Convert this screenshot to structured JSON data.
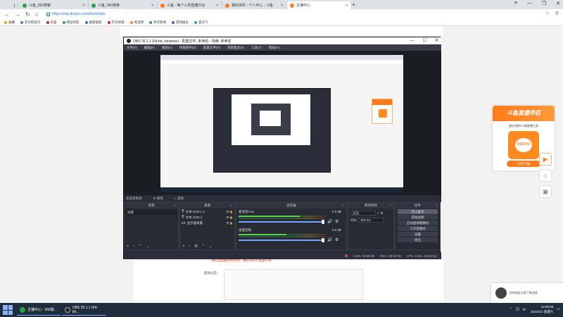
{
  "browser": {
    "tabs": [
      {
        "label": "斗鱼_360搜索",
        "active": false
      },
      {
        "label": "斗鱼_360搜索",
        "active": false
      },
      {
        "label": "斗鱼 - 每个人的直播平台",
        "active": false
      },
      {
        "label": "我的资料 - 个人中心 - 斗鱼",
        "active": false
      },
      {
        "label": "主播中心",
        "active": true
      }
    ],
    "url": "https://mp.douyu.com/live/main",
    "bookmarks": [
      {
        "label": "收藏",
        "color": "#f0a020"
      },
      {
        "label": "老司机首页",
        "color": "#3b7de0"
      },
      {
        "label": "天猫",
        "color": "#e02020"
      },
      {
        "label": "网址导航",
        "color": "#2aa04a"
      },
      {
        "label": "搜索搜索",
        "color": "#2a6de0"
      },
      {
        "label": "京东商城",
        "color": "#e02020"
      },
      {
        "label": "淘宝网",
        "color": "#ff7a1a"
      },
      {
        "label": "热点新闻",
        "color": "#3b7de0"
      },
      {
        "label": "游戏娱乐",
        "color": "#7a3be0"
      },
      {
        "label": "查天气",
        "color": "#20a0e0"
      }
    ]
  },
  "obs": {
    "title": "OBS 26.1.1 (64-bit, windows) - 配置文件: 未命名 - 场景: 未命名",
    "menu": [
      "文件(F)",
      "编辑(E)",
      "视图(V)",
      "停靠部件(D)",
      "配置文件(P)",
      "场景集合(S)",
      "工具(T)",
      "帮助(H)"
    ],
    "source_bar": {
      "none_selected": "未选择来源",
      "properties": "属性",
      "filters": "滤镜"
    },
    "scenes": {
      "header": "场景",
      "items": [
        "场景"
      ]
    },
    "sources": {
      "header": "来源",
      "items": [
        {
          "type": "T",
          "label": "文本 (GDI+) 2"
        },
        {
          "type": "T",
          "label": "文本 (GDI+)"
        },
        {
          "type": "▭",
          "label": "显示器采集"
        }
      ]
    },
    "mixer": {
      "header": "混音器",
      "channels": [
        {
          "name": "麦克风/Aux",
          "db": "0.0 dB",
          "level": 0.7
        },
        {
          "name": "桌面音频",
          "db": "0.0 dB",
          "level": 0.55
        }
      ]
    },
    "transitions": {
      "header": "转场特效",
      "type": "淡出",
      "duration_label": "时长",
      "duration": "300 ms"
    },
    "controls": {
      "header": "控件",
      "buttons": [
        "停止推流",
        "开始录制",
        "启动虚拟摄像机",
        "工作室模式",
        "设置",
        "退出"
      ]
    },
    "status": {
      "live": "LIVE: 00:00:00",
      "rec": "REC: 00:00:00",
      "cpu": "CPU: 0.0%, 30.00 fps"
    }
  },
  "page": {
    "notice": "请和谐直播文明用语，维护良好的直播环境",
    "announcement_label": "房间公告:",
    "promo": {
      "title": "斗鱼直播伴侣",
      "subtitle": "超好用的PC端直播工具",
      "button": "立即下载",
      "logo_text": "DOUYU"
    },
    "notification": "您的朋友分享了新消息"
  },
  "taskbar": {
    "items": [
      "主播中心 - 360极...",
      "OBS 26.1.1 (64-bit..."
    ],
    "time": "12:06:08",
    "date": "2022/1/1 星期六"
  }
}
